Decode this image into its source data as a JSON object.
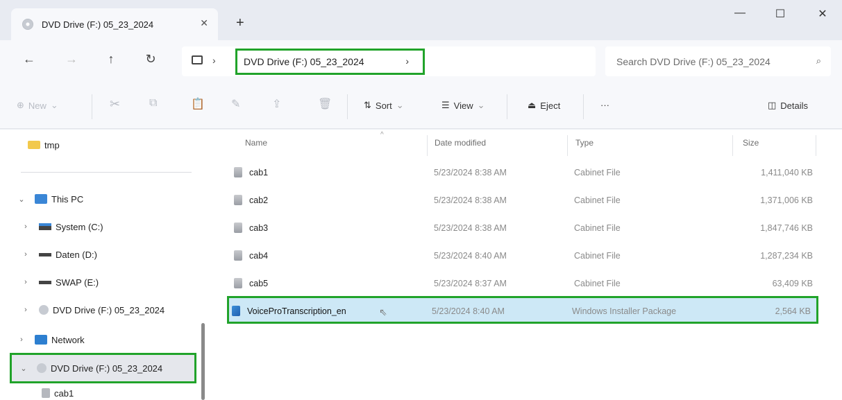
{
  "tab": {
    "title": "DVD Drive (F:) 05_23_2024",
    "close": "✕",
    "new": "+"
  },
  "window": {
    "minimize": "—",
    "maximize": "☐",
    "close": "✕"
  },
  "nav": {
    "back": "←",
    "forward": "→",
    "up": "↑",
    "refresh": "↻"
  },
  "address": {
    "separator": "›",
    "crumb": "DVD Drive (F:) 05_23_2024",
    "crumb_chevron": "›"
  },
  "search": {
    "placeholder": "Search DVD Drive (F:) 05_23_2024",
    "icon": "⌕"
  },
  "toolbar": {
    "new": "New",
    "sort": "Sort",
    "view": "View",
    "eject": "Eject",
    "more": "···",
    "details": "Details"
  },
  "sidebar": {
    "items": [
      {
        "label": "tmp",
        "expander": ""
      },
      {
        "label": "This PC",
        "expander": "⌄"
      },
      {
        "label": "System (C:)",
        "expander": "›"
      },
      {
        "label": "Daten (D:)",
        "expander": "›"
      },
      {
        "label": "SWAP (E:)",
        "expander": "›"
      },
      {
        "label": "DVD Drive (F:) 05_23_2024",
        "expander": "›"
      },
      {
        "label": "Network",
        "expander": "›"
      },
      {
        "label": "DVD Drive (F:) 05_23_2024",
        "expander": "⌄"
      },
      {
        "label": "cab1",
        "expander": ""
      }
    ]
  },
  "columns": {
    "name": "Name",
    "date": "Date modified",
    "type": "Type",
    "size": "Size"
  },
  "files": [
    {
      "name": "cab1",
      "date": "5/23/2024 8:38 AM",
      "type": "Cabinet File",
      "size": "1,411,040 KB"
    },
    {
      "name": "cab2",
      "date": "5/23/2024 8:38 AM",
      "type": "Cabinet File",
      "size": "1,371,006 KB"
    },
    {
      "name": "cab3",
      "date": "5/23/2024 8:38 AM",
      "type": "Cabinet File",
      "size": "1,847,746 KB"
    },
    {
      "name": "cab4",
      "date": "5/23/2024 8:40 AM",
      "type": "Cabinet File",
      "size": "1,287,234 KB"
    },
    {
      "name": "cab5",
      "date": "5/23/2024 8:37 AM",
      "type": "Cabinet File",
      "size": "63,409 KB"
    },
    {
      "name": "VoiceProTranscription_en",
      "date": "5/23/2024 8:40 AM",
      "type": "Windows Installer Package",
      "size": "2,564 KB"
    }
  ],
  "colors": {
    "highlight": "#21a32a",
    "selection": "#cde8f6"
  }
}
